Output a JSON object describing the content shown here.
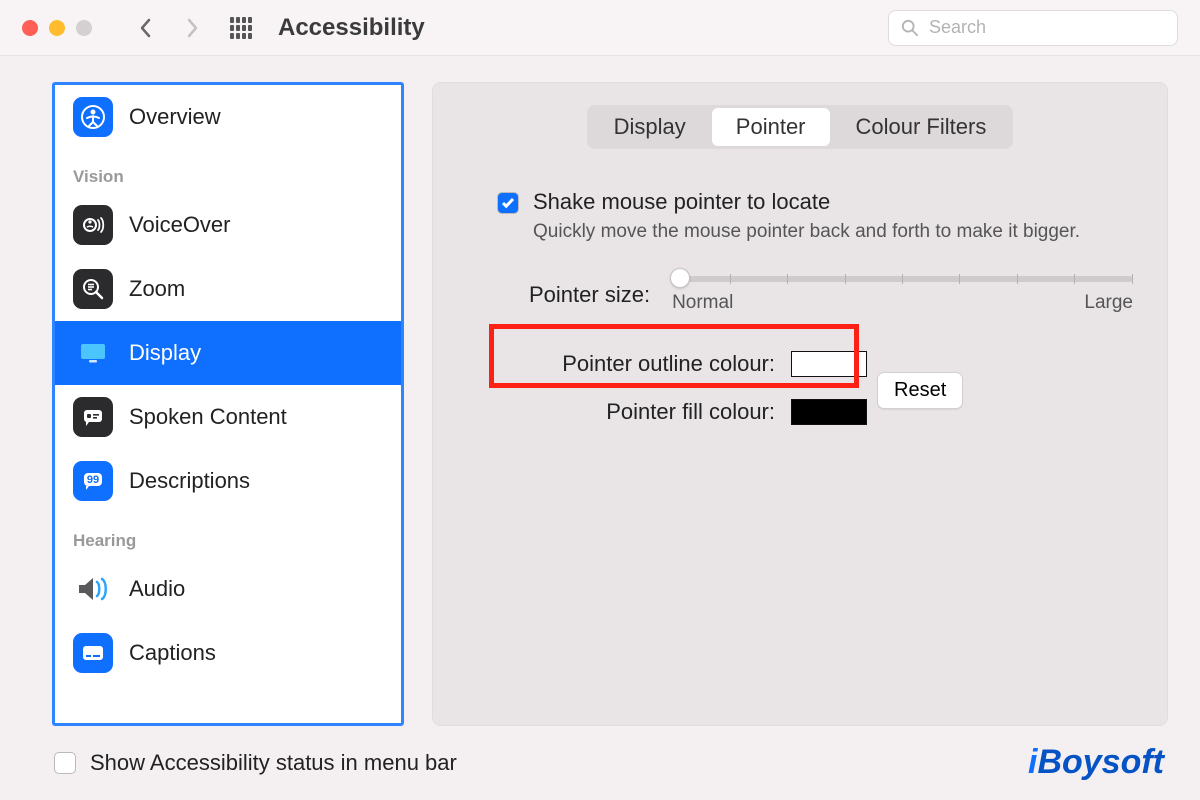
{
  "window": {
    "title": "Accessibility"
  },
  "search": {
    "placeholder": "Search"
  },
  "sidebar": {
    "items": [
      {
        "label": "Overview"
      }
    ],
    "sections": [
      {
        "header": "Vision",
        "items": [
          {
            "label": "VoiceOver"
          },
          {
            "label": "Zoom"
          },
          {
            "label": "Display",
            "selected": true
          },
          {
            "label": "Spoken Content"
          },
          {
            "label": "Descriptions"
          }
        ]
      },
      {
        "header": "Hearing",
        "items": [
          {
            "label": "Audio"
          },
          {
            "label": "Captions"
          }
        ]
      }
    ]
  },
  "tabs": {
    "items": [
      "Display",
      "Pointer",
      "Colour Filters"
    ],
    "active": "Pointer"
  },
  "pointer": {
    "shake_label": "Shake mouse pointer to locate",
    "shake_desc": "Quickly move the mouse pointer back and forth to make it bigger.",
    "size_label": "Pointer size:",
    "size_min": "Normal",
    "size_max": "Large",
    "outline_label": "Pointer outline colour:",
    "fill_label": "Pointer fill colour:",
    "reset": "Reset",
    "outline_color": "#ffffff",
    "fill_color": "#000000"
  },
  "footer": {
    "show_status": "Show Accessibility status in menu bar"
  },
  "brand": "iBoysoft",
  "colors": {
    "accent": "#0f6fff",
    "callout": "#ff2015",
    "brand": "#0653c6"
  }
}
